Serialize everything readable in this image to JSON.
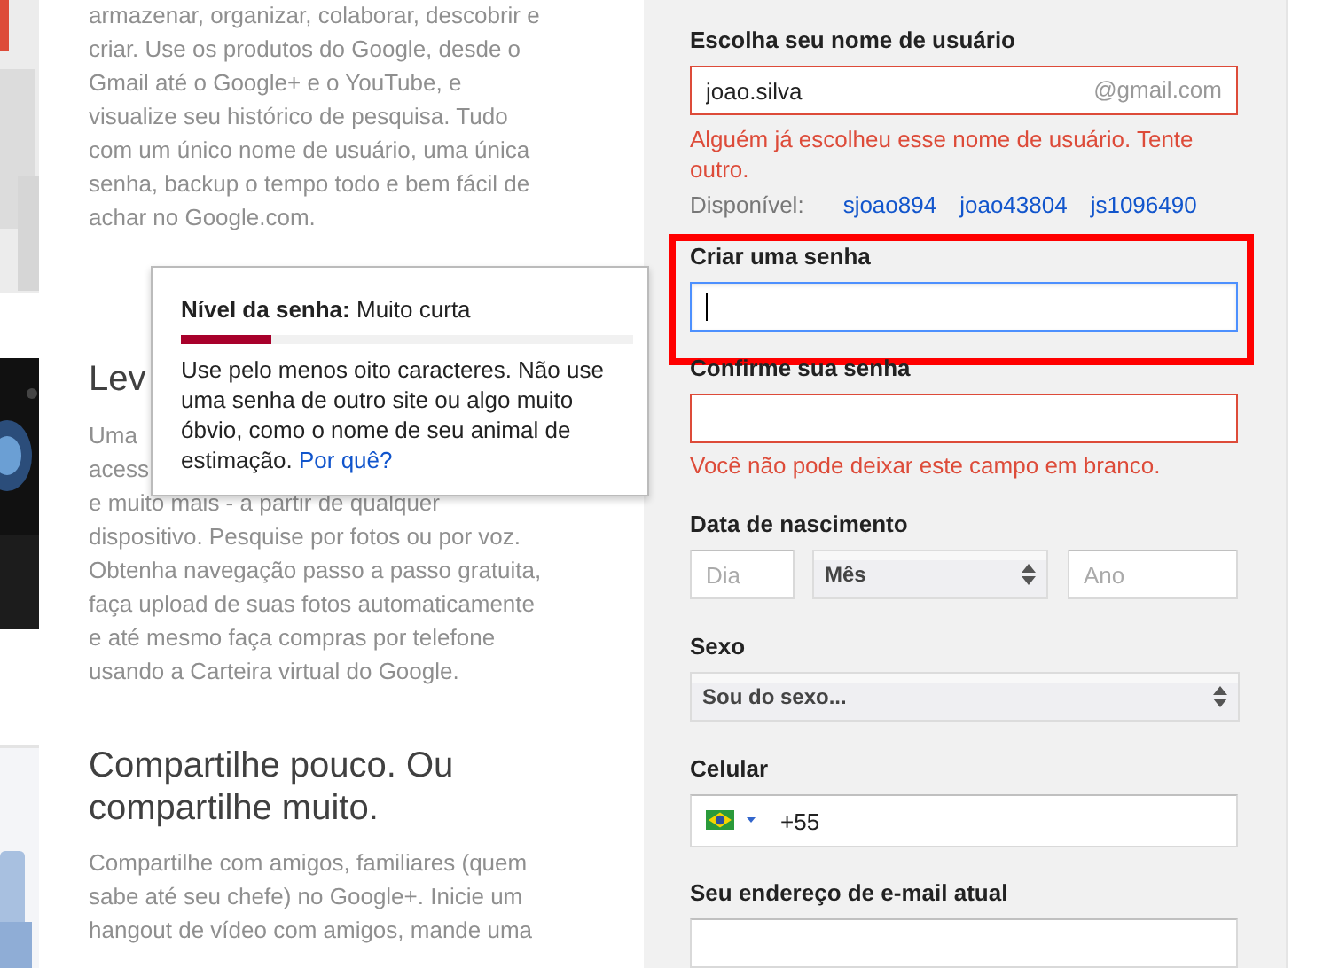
{
  "intro": {
    "paragraph": "armazenar, organizar, colaborar, descobrir e criar. Use os produtos do Google, desde o Gmail até o Google+ e o YouTube, e visualize seu histórico de pesquisa. Tudo com um único nome de usuário, uma única senha, backup o tempo todo e bem fácil de achar no Google.com."
  },
  "section_2": {
    "heading": "Lev",
    "lines": [
      "Uma",
      "acess"
    ],
    "paragraph": "e muito mais - a partir de qualquer dispositivo. Pesquise por fotos ou por voz. Obtenha navegação passo a passo gratuita, faça upload de suas fotos automaticamente e até mesmo faça compras por telefone usando a Carteira virtual do Google."
  },
  "section_3": {
    "heading": "Compartilhe pouco. Ou compartilhe muito.",
    "paragraph": "Compartilhe com amigos, familiares (quem sabe até seu chefe) no Google+. Inicie um hangout de vídeo com amigos, mande uma"
  },
  "password_tooltip": {
    "label": "Nível da senha:",
    "value": "Muito curta",
    "level": 0.2,
    "text": "Use pelo menos oito caracteres. Não use uma senha de outro site ou algo muito óbvio, como o nome de seu animal de estimação.",
    "link": "Por quê?"
  },
  "form": {
    "username": {
      "label": "Escolha seu nome de usuário",
      "value": "joao.silva",
      "suffix": "@gmail.com",
      "invalid": true,
      "error": "Alguém já escolheu esse nome de usuário. Tente outro."
    },
    "suggestions": {
      "label": "Disponível:",
      "options": [
        "sjoao894",
        "joao43804",
        "js1096490"
      ]
    },
    "password": {
      "label": "Criar uma senha",
      "focused": true,
      "highlighted": true
    },
    "confirm_password": {
      "label": "Confirme sua senha",
      "invalid": true,
      "error": "Você não pode deixar este campo em branco."
    },
    "birthdate": {
      "label": "Data de nascimento",
      "day_placeholder": "Dia",
      "month": "Mês",
      "year_placeholder": "Ano"
    },
    "gender": {
      "label": "Sexo",
      "value": "Sou do sexo..."
    },
    "phone": {
      "label": "Celular",
      "value": "+55"
    },
    "email": {
      "label": "Seu endereço de e-mail atual"
    }
  }
}
